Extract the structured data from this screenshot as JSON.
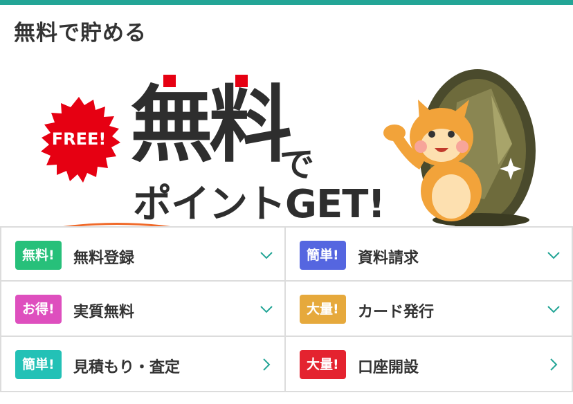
{
  "header": {
    "title": "無料で貯める"
  },
  "banner": {
    "badge_text": "FREE!",
    "headline_big": "無料",
    "headline_de": "で",
    "headline_sub": "ポイントGET!"
  },
  "colors": {
    "accent": "#23a596",
    "red": "#e60012",
    "annotation": "#f06a2a"
  },
  "menu": [
    {
      "badge": "無料!",
      "label": "無料登録",
      "badge_color": "#27c07a",
      "icon": "chevron-down-icon"
    },
    {
      "badge": "簡単!",
      "label": "資料請求",
      "badge_color": "#5566e0",
      "icon": "chevron-down-icon"
    },
    {
      "badge": "お得!",
      "label": "実質無料",
      "badge_color": "#de4fbe",
      "icon": "chevron-down-icon"
    },
    {
      "badge": "大量!",
      "label": "カード発行",
      "badge_color": "#e6a93c",
      "icon": "chevron-down-icon"
    },
    {
      "badge": "簡単!",
      "label": "見積もり・査定",
      "badge_color": "#23c1b6",
      "icon": "chevron-right-icon"
    },
    {
      "badge": "大量!",
      "label": "口座開設",
      "badge_color": "#e4232f",
      "icon": "chevron-right-icon"
    }
  ]
}
